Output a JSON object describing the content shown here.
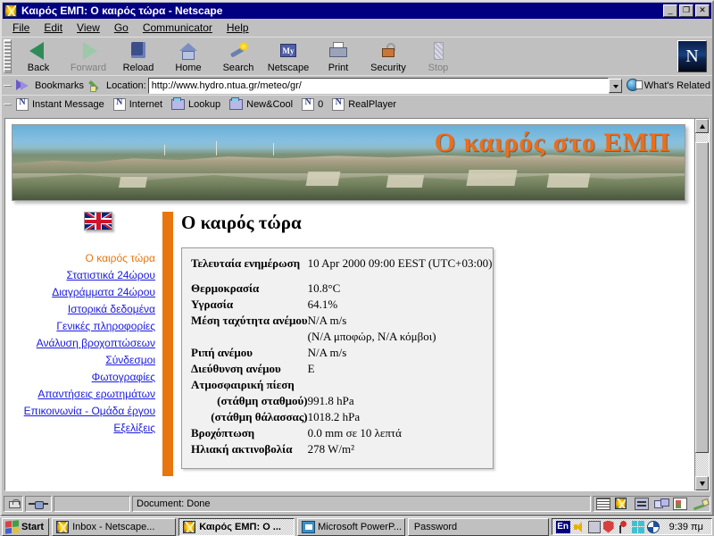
{
  "window": {
    "title": "Καιρός ΕΜΠ: Ο καιρός τώρα - Netscape",
    "minimize": "_",
    "maximize": "❐",
    "close": "✕"
  },
  "menu": [
    {
      "label": "File"
    },
    {
      "label": "Edit"
    },
    {
      "label": "View"
    },
    {
      "label": "Go"
    },
    {
      "label": "Communicator"
    },
    {
      "label": "Help"
    }
  ],
  "toolbar": {
    "buttons": [
      {
        "label": "Back",
        "icon": "back-arrow-icon",
        "disabled": false
      },
      {
        "label": "Forward",
        "icon": "forward-arrow-icon",
        "disabled": true
      },
      {
        "label": "Reload",
        "icon": "reload-icon",
        "disabled": false
      },
      {
        "label": "Home",
        "icon": "home-icon",
        "disabled": false
      },
      {
        "label": "Search",
        "icon": "search-flashlight-icon",
        "disabled": false
      },
      {
        "label": "Netscape",
        "icon": "my-netscape-icon",
        "disabled": false
      },
      {
        "label": "Print",
        "icon": "printer-icon",
        "disabled": false
      },
      {
        "label": "Security",
        "icon": "open-padlock-icon",
        "disabled": false
      },
      {
        "label": "Stop",
        "icon": "stop-sign-icon",
        "disabled": true
      }
    ],
    "logo_letter": "N"
  },
  "location_bar": {
    "bookmarks_label": "Bookmarks",
    "location_label": "Location:",
    "url": "http://www.hydro.ntua.gr/meteo/gr/",
    "whats_related_label": "What's Related"
  },
  "personal_toolbar": [
    {
      "label": "Instant Message",
      "icon": "netscape-page-icon"
    },
    {
      "label": "Internet",
      "icon": "netscape-page-icon"
    },
    {
      "label": "Lookup",
      "icon": "folder-icon"
    },
    {
      "label": "New&Cool",
      "icon": "folder-icon"
    },
    {
      "label": "0",
      "icon": "netscape-page-icon"
    },
    {
      "label": "RealPlayer",
      "icon": "netscape-page-icon"
    }
  ],
  "page": {
    "banner_title": "Ο καιρός στο ΕΜΠ",
    "flag_alt": "uk-flag-icon",
    "nav": [
      {
        "label": "Ο καιρός τώρα",
        "current": true
      },
      {
        "label": "Στατιστικά 24ώρου",
        "current": false
      },
      {
        "label": "Διαγράμματα 24ώρου",
        "current": false
      },
      {
        "label": "Ιστορικά δεδομένα",
        "current": false
      },
      {
        "label": "Γενικές πληροφορίες",
        "current": false
      },
      {
        "label": "Ανάλυση βροχοπτώσεων",
        "current": false
      },
      {
        "label": "Σύνδεσμοι",
        "current": false
      },
      {
        "label": "Φωτογραφίες",
        "current": false
      },
      {
        "label": "Απαντήσεις ερωτημάτων",
        "current": false
      },
      {
        "label": "Επικοινωνία - Ομάδα έργου",
        "current": false
      },
      {
        "label": "Εξελίξεις",
        "current": false
      }
    ],
    "heading": "Ο καιρός τώρα",
    "accent_color": "#e8760e",
    "link_color": "#1a1ae0",
    "observations": [
      {
        "label": "Τελευταία ενημέρωση",
        "value": "10 Apr 2000 09:00 EEST (UTC+03:00)",
        "indent": false
      },
      {
        "label": "Θερμοκρασία",
        "value": "10.8°C",
        "indent": false
      },
      {
        "label": "Υγρασία",
        "value": "64.1%",
        "indent": false
      },
      {
        "label": "Μέση ταχύτητα ανέμου",
        "value": "N/A m/s",
        "indent": false
      },
      {
        "label": "",
        "value": "(N/A μποφώρ, N/A κόμβοι)",
        "indent": false
      },
      {
        "label": "Ριπή ανέμου",
        "value": "N/A m/s",
        "indent": false
      },
      {
        "label": "Διεύθυνση ανέμου",
        "value": "E",
        "indent": false
      },
      {
        "label": "Ατμοσφαιρική πίεση",
        "value": "",
        "indent": false
      },
      {
        "label": "(στάθμη σταθμού)",
        "value": "991.8 hPa",
        "indent": true
      },
      {
        "label": "(στάθμη θάλασσας)",
        "value": "1018.2 hPa",
        "indent": true
      },
      {
        "label": "Βροχόπτωση",
        "value": "0.0 mm σε 10 λεπτά",
        "indent": false
      },
      {
        "label": "Ηλιακή ακτινοβολία",
        "value": "278 W/m²",
        "indent": false
      }
    ]
  },
  "status_bar": {
    "message": "Document: Done",
    "icons": [
      "security-lock-icon",
      "connection-icon",
      "progress-bar",
      "message-list-icon",
      "netscape-star-icon",
      "newsgroup-icon",
      "compose-icon",
      "addressbook-icon",
      "composer-icon"
    ]
  },
  "taskbar": {
    "start_label": "Start",
    "tasks": [
      {
        "label": "Inbox - Netscape...",
        "icon": "netscape-mail-icon",
        "active": false
      },
      {
        "label": "Καιρός ΕΜΠ: Ο ...",
        "icon": "netscape-icon",
        "active": true
      },
      {
        "label": "Microsoft PowerP...",
        "icon": "powerpoint-icon",
        "active": false
      },
      {
        "label": "Password",
        "icon": "none",
        "active": false
      }
    ],
    "tray": {
      "language": "En",
      "icons": [
        "speaker-icon",
        "modem-icon",
        "antivirus-shield-icon",
        "pin-icon",
        "squares-icon",
        "globe-icon"
      ],
      "clock": "9:39 πμ"
    }
  }
}
